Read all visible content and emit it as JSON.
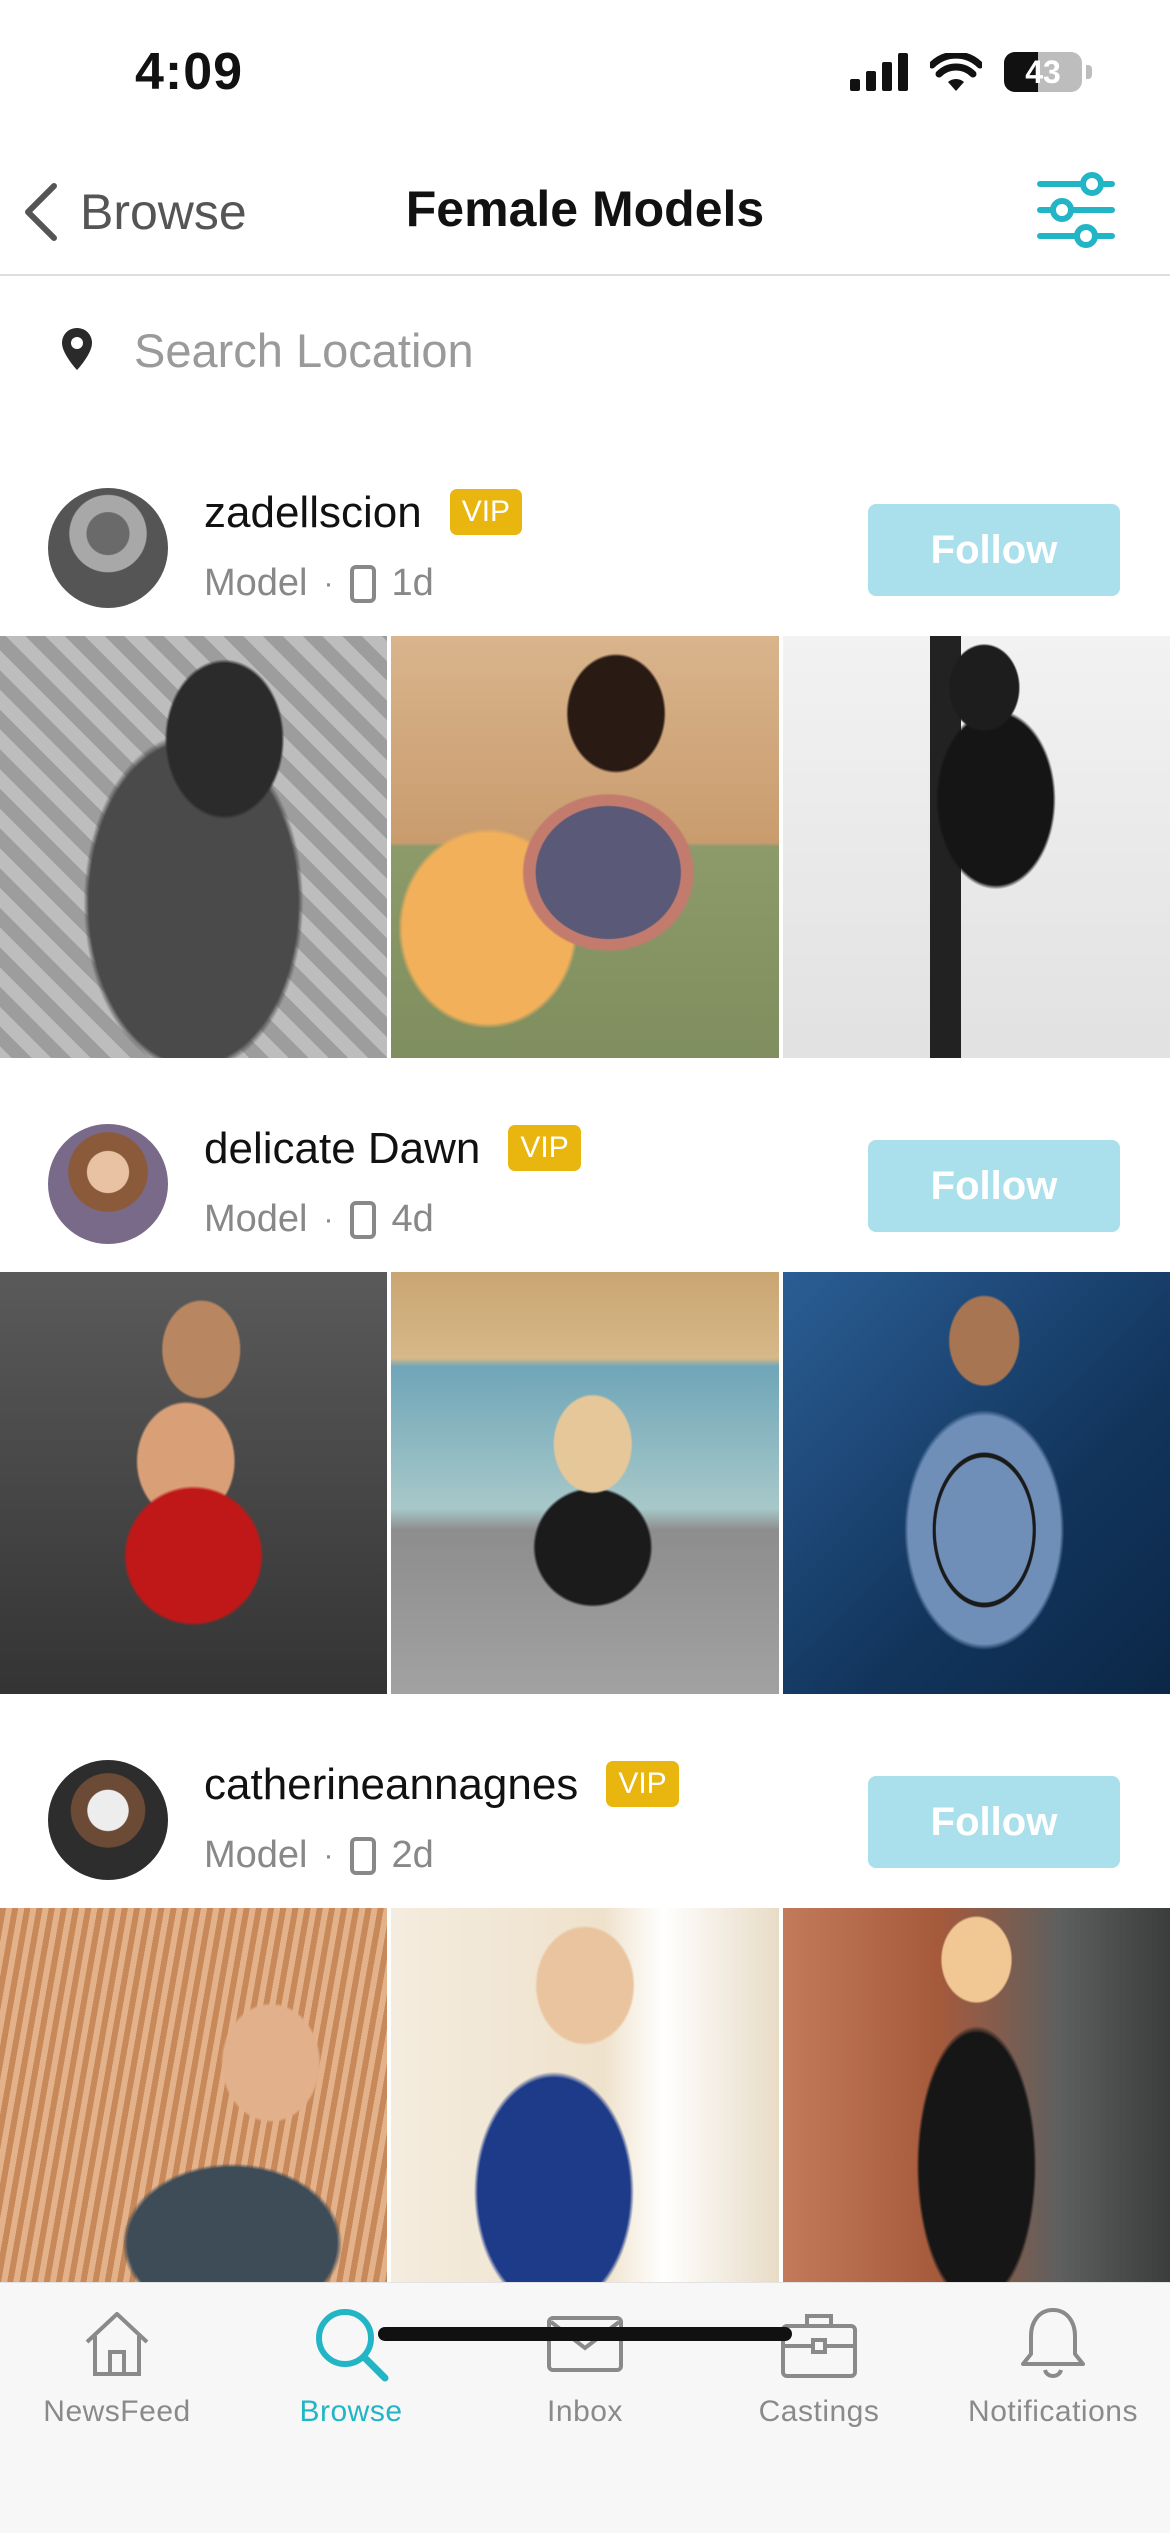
{
  "status_bar": {
    "time": "4:09",
    "battery": "43",
    "battery_level": 0.43
  },
  "nav": {
    "back_label": "Browse",
    "title": "Female Models"
  },
  "search": {
    "placeholder": "Search Location"
  },
  "accent_color": "#22b5c6",
  "feed": [
    {
      "username": "zadellscion",
      "badge": "VIP",
      "role": "Model",
      "separator": "·",
      "time_ago": "1d",
      "follow_label": "Follow",
      "photos": [
        "bw-portrait-lace-dress",
        "patterned-robe-on-sofa",
        "bw-stool-boots"
      ]
    },
    {
      "username": "delicate Dawn",
      "badge": "VIP",
      "role": "Model",
      "separator": "·",
      "time_ago": "4d",
      "follow_label": "Follow",
      "photos": [
        "red-dress-studio",
        "black-dress-canal",
        "blue-floral-dress"
      ]
    },
    {
      "username": "catherineannagnes",
      "badge": "VIP",
      "role": "Model",
      "separator": "·",
      "time_ago": "2d",
      "follow_label": "Follow",
      "photos": [
        "field-sunset-portrait",
        "blue-dress-doorway",
        "black-jumpsuit-brick"
      ]
    }
  ],
  "tabs": [
    {
      "label": "NewsFeed",
      "icon": "home-icon",
      "active": false
    },
    {
      "label": "Browse",
      "icon": "search-icon",
      "active": true
    },
    {
      "label": "Inbox",
      "icon": "mail-icon",
      "active": false
    },
    {
      "label": "Castings",
      "icon": "briefcase-icon",
      "active": false
    },
    {
      "label": "Notifications",
      "icon": "bell-icon",
      "active": false
    }
  ]
}
